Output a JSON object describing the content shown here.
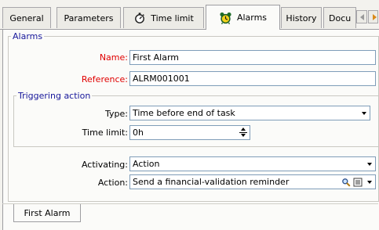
{
  "tabs": [
    {
      "label": "General",
      "icon": null
    },
    {
      "label": "Parameters",
      "icon": null
    },
    {
      "label": "Time limit",
      "icon": "stopwatch-icon"
    },
    {
      "label": "Alarms",
      "icon": "alarm-clock-icon"
    },
    {
      "label": "History",
      "icon": null
    },
    {
      "label": "Docu",
      "icon": null
    }
  ],
  "active_tab": "Alarms",
  "alarms_group": {
    "legend": "Alarms",
    "name_label": "Name:",
    "name_value": "First Alarm",
    "reference_label": "Reference:",
    "reference_value": "ALRM001001"
  },
  "triggering_group": {
    "legend": "Triggering action",
    "type_label": "Type:",
    "type_value": "Time before end of task",
    "time_limit_label": "Time limit:",
    "time_limit_value": "0h"
  },
  "activating": {
    "label": "Activating:",
    "value": "Action"
  },
  "action": {
    "label": "Action:",
    "value": "Send a financial-validation reminder"
  },
  "bottom_tab": {
    "label": "First Alarm"
  },
  "colors": {
    "required_label": "#e00000",
    "group_legend": "#16169a",
    "field_border": "#7f9db9"
  }
}
